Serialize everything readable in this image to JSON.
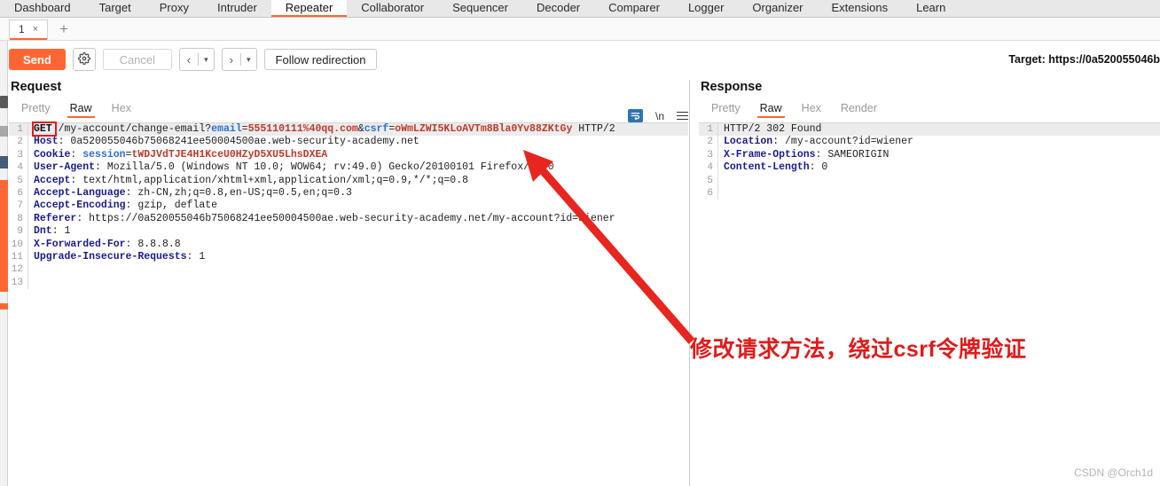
{
  "app": {
    "main_tabs": [
      {
        "label": "Dashboard",
        "active": false
      },
      {
        "label": "Target",
        "active": false
      },
      {
        "label": "Proxy",
        "active": false
      },
      {
        "label": "Intruder",
        "active": false
      },
      {
        "label": "Repeater",
        "active": true
      },
      {
        "label": "Collaborator",
        "active": false
      },
      {
        "label": "Sequencer",
        "active": false
      },
      {
        "label": "Decoder",
        "active": false
      },
      {
        "label": "Comparer",
        "active": false
      },
      {
        "label": "Logger",
        "active": false
      },
      {
        "label": "Organizer",
        "active": false
      },
      {
        "label": "Extensions",
        "active": false
      },
      {
        "label": "Learn",
        "active": false
      }
    ],
    "accent_color": "#ff6633"
  },
  "repeater": {
    "tab_label": "1",
    "tab_close": "×",
    "add_tab": "+"
  },
  "toolbar": {
    "send_label": "Send",
    "gear_icon": "gear-icon",
    "cancel_label": "Cancel",
    "back_caret": "▾",
    "forward_caret": "▾",
    "back_chevron": "‹",
    "forward_chevron": "›",
    "follow_redirection_label": "Follow redirection",
    "target_label": "Target: https://0a520055046b"
  },
  "request": {
    "title": "Request",
    "view_tabs": [
      {
        "label": "Pretty",
        "active": false
      },
      {
        "label": "Raw",
        "active": true
      },
      {
        "label": "Hex",
        "active": false
      }
    ],
    "tools": {
      "wrap_icon": "word-wrap-icon",
      "newline_label": "\\n",
      "menu_icon": "hamburger-menu-icon"
    },
    "lines": [
      {
        "n": "1",
        "segments": [
          {
            "t": "GET ",
            "c": "mth"
          },
          {
            "t": "/my-account/change-email?",
            "c": "url"
          },
          {
            "t": "email",
            "c": "pk"
          },
          {
            "t": "=",
            "c": "plain"
          },
          {
            "t": "555110111%40qq.com",
            "c": "pv"
          },
          {
            "t": "&",
            "c": "plain"
          },
          {
            "t": "csrf",
            "c": "pk"
          },
          {
            "t": "=",
            "c": "plain"
          },
          {
            "t": "oWmLZWI5KLoAVTm8Bla0Yv88ZKtGy",
            "c": "pv"
          },
          {
            "t": " HTTP/2",
            "c": "plain"
          }
        ]
      },
      {
        "n": "2",
        "segments": [
          {
            "t": "Host",
            "c": "hk"
          },
          {
            "t": ": 0a520055046b75068241ee50004500ae.web-security-academy.net",
            "c": "hv"
          }
        ]
      },
      {
        "n": "3",
        "segments": [
          {
            "t": "Cookie",
            "c": "hk"
          },
          {
            "t": ": ",
            "c": "hv"
          },
          {
            "t": "session",
            "c": "pk"
          },
          {
            "t": "=",
            "c": "plain"
          },
          {
            "t": "tWDJVdTJE4H1KceU0HZyD5XU5LhsDXEA",
            "c": "pv"
          }
        ]
      },
      {
        "n": "4",
        "segments": [
          {
            "t": "User-Agent",
            "c": "hk"
          },
          {
            "t": ": Mozilla/5.0 (Windows NT 10.0; WOW64; rv:49.0) Gecko/20100101 Firefox/49.0",
            "c": "hv"
          }
        ]
      },
      {
        "n": "5",
        "segments": [
          {
            "t": "Accept",
            "c": "hk"
          },
          {
            "t": ": text/html,application/xhtml+xml,application/xml;q=0.9,*/*;q=0.8",
            "c": "hv"
          }
        ]
      },
      {
        "n": "6",
        "segments": [
          {
            "t": "Accept-Language",
            "c": "hk"
          },
          {
            "t": ": zh-CN,zh;q=0.8,en-US;q=0.5,en;q=0.3",
            "c": "hv"
          }
        ]
      },
      {
        "n": "7",
        "segments": [
          {
            "t": "Accept-Encoding",
            "c": "hk"
          },
          {
            "t": ": gzip, deflate",
            "c": "hv"
          }
        ]
      },
      {
        "n": "8",
        "segments": [
          {
            "t": "Referer",
            "c": "hk"
          },
          {
            "t": ": https://0a520055046b75068241ee50004500ae.web-security-academy.net/my-account?id=wiener",
            "c": "hv"
          }
        ]
      },
      {
        "n": "9",
        "segments": [
          {
            "t": "Dnt",
            "c": "hk"
          },
          {
            "t": ": 1",
            "c": "hv"
          }
        ]
      },
      {
        "n": "10",
        "segments": [
          {
            "t": "X-Forwarded-For",
            "c": "hk"
          },
          {
            "t": ": 8.8.8.8",
            "c": "hv"
          }
        ]
      },
      {
        "n": "11",
        "segments": [
          {
            "t": "Upgrade-Insecure-Requests",
            "c": "hk"
          },
          {
            "t": ": 1",
            "c": "hv"
          }
        ]
      },
      {
        "n": "12",
        "segments": []
      },
      {
        "n": "13",
        "segments": []
      }
    ]
  },
  "response": {
    "title": "Response",
    "view_tabs": [
      {
        "label": "Pretty",
        "active": false
      },
      {
        "label": "Raw",
        "active": true
      },
      {
        "label": "Hex",
        "active": false
      },
      {
        "label": "Render",
        "active": false
      }
    ],
    "lines": [
      {
        "n": "1",
        "segments": [
          {
            "t": "HTTP/2 302 Found",
            "c": "plain"
          }
        ]
      },
      {
        "n": "2",
        "segments": [
          {
            "t": "Location",
            "c": "hk"
          },
          {
            "t": ": /my-account?id=wiener",
            "c": "hv"
          }
        ]
      },
      {
        "n": "3",
        "segments": [
          {
            "t": "X-Frame-Options",
            "c": "hk"
          },
          {
            "t": ": SAMEORIGIN",
            "c": "hv"
          }
        ]
      },
      {
        "n": "4",
        "segments": [
          {
            "t": "Content-Length",
            "c": "hk"
          },
          {
            "t": ": 0",
            "c": "hv"
          }
        ]
      },
      {
        "n": "5",
        "segments": []
      },
      {
        "n": "6",
        "segments": []
      }
    ]
  },
  "annotations": {
    "note_text": "修改请求方法，绕过csrf令牌验证",
    "note_color": "#e01b1b",
    "arrow_name": "red-annotation-arrow",
    "highlight_box_name": "get-method-highlight"
  },
  "watermark": {
    "text": "CSDN @Orch1d"
  }
}
